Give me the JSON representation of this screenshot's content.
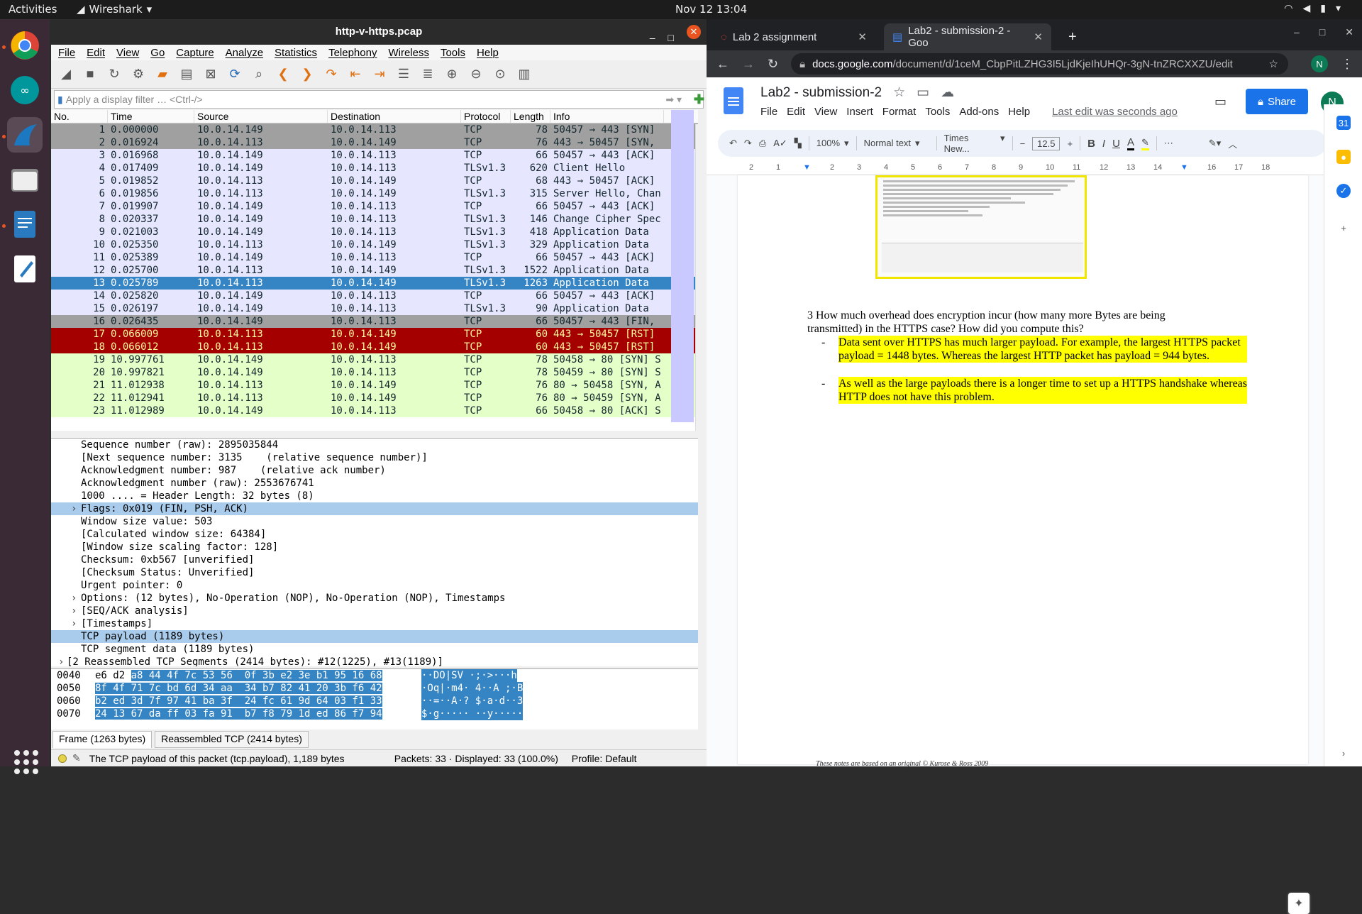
{
  "topbar": {
    "activities": "Activities",
    "app": "Wireshark",
    "clock": "Nov 12  13:04"
  },
  "wireshark": {
    "title": "http-v-https.pcap",
    "menu": [
      "File",
      "Edit",
      "View",
      "Go",
      "Capture",
      "Analyze",
      "Statistics",
      "Telephony",
      "Wireless",
      "Tools",
      "Help"
    ],
    "filter_placeholder": "Apply a display filter … <Ctrl-/>",
    "columns": [
      "No.",
      "Time",
      "Source",
      "Destination",
      "Protocol",
      "Length",
      "Info"
    ],
    "packets": [
      {
        "no": "1",
        "time": "0.000000",
        "src": "10.0.14.149",
        "dst": "10.0.14.113",
        "proto": "TCP",
        "len": "78",
        "info": "50457 → 443 [SYN]",
        "bg": "#a0a0a0",
        "fg": "#12272e"
      },
      {
        "no": "2",
        "time": "0.016924",
        "src": "10.0.14.113",
        "dst": "10.0.14.149",
        "proto": "TCP",
        "len": "76",
        "info": "443 → 50457 [SYN,",
        "bg": "#a0a0a0",
        "fg": "#12272e"
      },
      {
        "no": "3",
        "time": "0.016968",
        "src": "10.0.14.149",
        "dst": "10.0.14.113",
        "proto": "TCP",
        "len": "66",
        "info": "50457 → 443 [ACK]",
        "bg": "#e7e6ff",
        "fg": "#12272e"
      },
      {
        "no": "4",
        "time": "0.017409",
        "src": "10.0.14.149",
        "dst": "10.0.14.113",
        "proto": "TLSv1.3",
        "len": "620",
        "info": "Client Hello",
        "bg": "#e7e6ff",
        "fg": "#12272e"
      },
      {
        "no": "5",
        "time": "0.019852",
        "src": "10.0.14.113",
        "dst": "10.0.14.149",
        "proto": "TCP",
        "len": "68",
        "info": "443 → 50457 [ACK]",
        "bg": "#e7e6ff",
        "fg": "#12272e"
      },
      {
        "no": "6",
        "time": "0.019856",
        "src": "10.0.14.113",
        "dst": "10.0.14.149",
        "proto": "TLSv1.3",
        "len": "315",
        "info": "Server Hello, Chan",
        "bg": "#e7e6ff",
        "fg": "#12272e"
      },
      {
        "no": "7",
        "time": "0.019907",
        "src": "10.0.14.149",
        "dst": "10.0.14.113",
        "proto": "TCP",
        "len": "66",
        "info": "50457 → 443 [ACK]",
        "bg": "#e7e6ff",
        "fg": "#12272e"
      },
      {
        "no": "8",
        "time": "0.020337",
        "src": "10.0.14.149",
        "dst": "10.0.14.113",
        "proto": "TLSv1.3",
        "len": "146",
        "info": "Change Cipher Spec",
        "bg": "#e7e6ff",
        "fg": "#12272e"
      },
      {
        "no": "9",
        "time": "0.021003",
        "src": "10.0.14.149",
        "dst": "10.0.14.113",
        "proto": "TLSv1.3",
        "len": "418",
        "info": "Application Data",
        "bg": "#e7e6ff",
        "fg": "#12272e"
      },
      {
        "no": "10",
        "time": "0.025350",
        "src": "10.0.14.113",
        "dst": "10.0.14.149",
        "proto": "TLSv1.3",
        "len": "329",
        "info": "Application Data",
        "bg": "#e7e6ff",
        "fg": "#12272e"
      },
      {
        "no": "11",
        "time": "0.025389",
        "src": "10.0.14.149",
        "dst": "10.0.14.113",
        "proto": "TCP",
        "len": "66",
        "info": "50457 → 443 [ACK]",
        "bg": "#e7e6ff",
        "fg": "#12272e"
      },
      {
        "no": "12",
        "time": "0.025700",
        "src": "10.0.14.113",
        "dst": "10.0.14.149",
        "proto": "TLSv1.3",
        "len": "1522",
        "info": "Application Data",
        "bg": "#e7e6ff",
        "fg": "#12272e"
      },
      {
        "no": "13",
        "time": "0.025789",
        "src": "10.0.14.113",
        "dst": "10.0.14.149",
        "proto": "TLSv1.3",
        "len": "1263",
        "info": "Application Data",
        "bg": "#3584c4",
        "fg": "#ffffff"
      },
      {
        "no": "14",
        "time": "0.025820",
        "src": "10.0.14.149",
        "dst": "10.0.14.113",
        "proto": "TCP",
        "len": "66",
        "info": "50457 → 443 [ACK]",
        "bg": "#e7e6ff",
        "fg": "#12272e"
      },
      {
        "no": "15",
        "time": "0.026197",
        "src": "10.0.14.149",
        "dst": "10.0.14.113",
        "proto": "TLSv1.3",
        "len": "90",
        "info": "Application Data",
        "bg": "#e7e6ff",
        "fg": "#12272e"
      },
      {
        "no": "16",
        "time": "0.026435",
        "src": "10.0.14.149",
        "dst": "10.0.14.113",
        "proto": "TCP",
        "len": "66",
        "info": "50457 → 443 [FIN,",
        "bg": "#a0a0a0",
        "fg": "#12272e"
      },
      {
        "no": "17",
        "time": "0.066009",
        "src": "10.0.14.113",
        "dst": "10.0.14.149",
        "proto": "TCP",
        "len": "60",
        "info": "443 → 50457 [RST]",
        "bg": "#a40000",
        "fg": "#fffc9c"
      },
      {
        "no": "18",
        "time": "0.066012",
        "src": "10.0.14.113",
        "dst": "10.0.14.149",
        "proto": "TCP",
        "len": "60",
        "info": "443 → 50457 [RST]",
        "bg": "#a40000",
        "fg": "#fffc9c"
      },
      {
        "no": "19",
        "time": "10.997761",
        "src": "10.0.14.149",
        "dst": "10.0.14.113",
        "proto": "TCP",
        "len": "78",
        "info": "50458 → 80 [SYN] S",
        "bg": "#e4ffc7",
        "fg": "#12272e"
      },
      {
        "no": "20",
        "time": "10.997821",
        "src": "10.0.14.149",
        "dst": "10.0.14.113",
        "proto": "TCP",
        "len": "78",
        "info": "50459 → 80 [SYN] S",
        "bg": "#e4ffc7",
        "fg": "#12272e"
      },
      {
        "no": "21",
        "time": "11.012938",
        "src": "10.0.14.113",
        "dst": "10.0.14.149",
        "proto": "TCP",
        "len": "76",
        "info": "80 → 50458 [SYN, A",
        "bg": "#e4ffc7",
        "fg": "#12272e"
      },
      {
        "no": "22",
        "time": "11.012941",
        "src": "10.0.14.113",
        "dst": "10.0.14.149",
        "proto": "TCP",
        "len": "76",
        "info": "80 → 50459 [SYN, A",
        "bg": "#e4ffc7",
        "fg": "#12272e"
      },
      {
        "no": "23",
        "time": "11.012989",
        "src": "10.0.14.149",
        "dst": "10.0.14.113",
        "proto": "TCP",
        "len": "66",
        "info": "50458 → 80 [ACK] S",
        "bg": "#e4ffc7",
        "fg": "#12272e"
      }
    ],
    "details": [
      {
        "t": "Sequence number (raw): 2895035844",
        "k": "plain"
      },
      {
        "t": "[Next sequence number: 3135    (relative sequence number)]",
        "k": "plain"
      },
      {
        "t": "Acknowledgment number: 987    (relative ack number)",
        "k": "plain"
      },
      {
        "t": "Acknowledgment number (raw): 2553676741",
        "k": "plain"
      },
      {
        "t": "1000 .... = Header Length: 32 bytes (8)",
        "k": "plain"
      },
      {
        "t": "Flags: 0x019 (FIN, PSH, ACK)",
        "k": "exp",
        "hl": "#a9ccec"
      },
      {
        "t": "Window size value: 503",
        "k": "plain"
      },
      {
        "t": "[Calculated window size: 64384]",
        "k": "plain"
      },
      {
        "t": "[Window size scaling factor: 128]",
        "k": "plain"
      },
      {
        "t": "Checksum: 0xb567 [unverified]",
        "k": "plain"
      },
      {
        "t": "[Checksum Status: Unverified]",
        "k": "plain"
      },
      {
        "t": "Urgent pointer: 0",
        "k": "plain"
      },
      {
        "t": "Options: (12 bytes), No-Operation (NOP), No-Operation (NOP), Timestamps",
        "k": "exp"
      },
      {
        "t": "[SEQ/ACK analysis]",
        "k": "exp"
      },
      {
        "t": "[Timestamps]",
        "k": "exp"
      },
      {
        "t": "TCP payload (1189 bytes)",
        "k": "plain",
        "hl": "#a9ccec"
      },
      {
        "t": "TCP segment data (1189 bytes)",
        "k": "plain"
      },
      {
        "t": "[2 Reassembled TCP Segments (2414 bytes): #12(1225), #13(1189)]",
        "k": "top-exp"
      }
    ],
    "hex": [
      {
        "off": "0040",
        "pre": "e6 d2 ",
        "sel": "a8 44 4f 7c 53 56  0f 3b e2 3e b1 95 16 68",
        "apre": "",
        "asel": "··DO|SV ·;·>···h"
      },
      {
        "off": "0050",
        "pre": "",
        "sel": "8f 4f 71 7c bd 6d 34 aa  34 b7 82 41 20 3b f6 42",
        "apre": "",
        "asel": "·Oq|·m4· 4··A ;·B"
      },
      {
        "off": "0060",
        "pre": "",
        "sel": "b2 ed 3d 7f 97 41 ba 3f  24 fc 61 9d 64 03 f1 33",
        "apre": "",
        "asel": "··=··A·? $·a·d··3"
      },
      {
        "off": "0070",
        "pre": "",
        "sel": "24 13 67 da ff 03 fa 91  b7 f8 79 1d ed 86 f7 94",
        "apre": "",
        "asel": "$·g····· ··y·····"
      }
    ],
    "tabs": [
      "Frame (1263 bytes)",
      "Reassembled TCP (2414 bytes)"
    ],
    "status": {
      "field": "The TCP payload of this packet (tcp.payload), 1,189 bytes",
      "packets": "Packets: 33 · Displayed: 33 (100.0%)",
      "profile": "Profile: Default"
    }
  },
  "chrome": {
    "tab1": "Lab 2 assignment",
    "tab2": "Lab2 - submission-2 - Goo",
    "url_domain": "docs.google.com",
    "url_path": "/document/d/1ceM_CbpPitLZHG3I5LjdKjeIhUHQr-3gN-tnZRCXXZU/edit",
    "avatar": "N"
  },
  "docs": {
    "title": "Lab2 - submission-2",
    "menu": [
      "File",
      "Edit",
      "View",
      "Insert",
      "Format",
      "Tools",
      "Add-ons",
      "Help"
    ],
    "last_edit": "Last edit was seconds ago",
    "share": "Share",
    "zoom": "100%",
    "style": "Normal text",
    "font": "Times New...",
    "size": "12.5",
    "ruler": [
      "2",
      "1",
      "1",
      "2",
      "3",
      "4",
      "5",
      "6",
      "7",
      "8",
      "9",
      "10",
      "11",
      "12",
      "13",
      "14",
      "15",
      "16",
      "17",
      "18"
    ],
    "question": "3 How much overhead does encryption incur (how many more Bytes are being transmitted) in the HTTPS case? How did you compute this?",
    "answers": [
      "Data sent over HTTPS has much larger payload. For example, the largest HTTPS packet payload = 1448 bytes. Whereas the largest HTTP packet has payload = 944 bytes.",
      "As well as the large payloads there is a longer time to set up a HTTPS handshake whereas HTTP does not have this problem."
    ],
    "footer": "These notes are based on an original © Kurose & Ross 2009"
  }
}
